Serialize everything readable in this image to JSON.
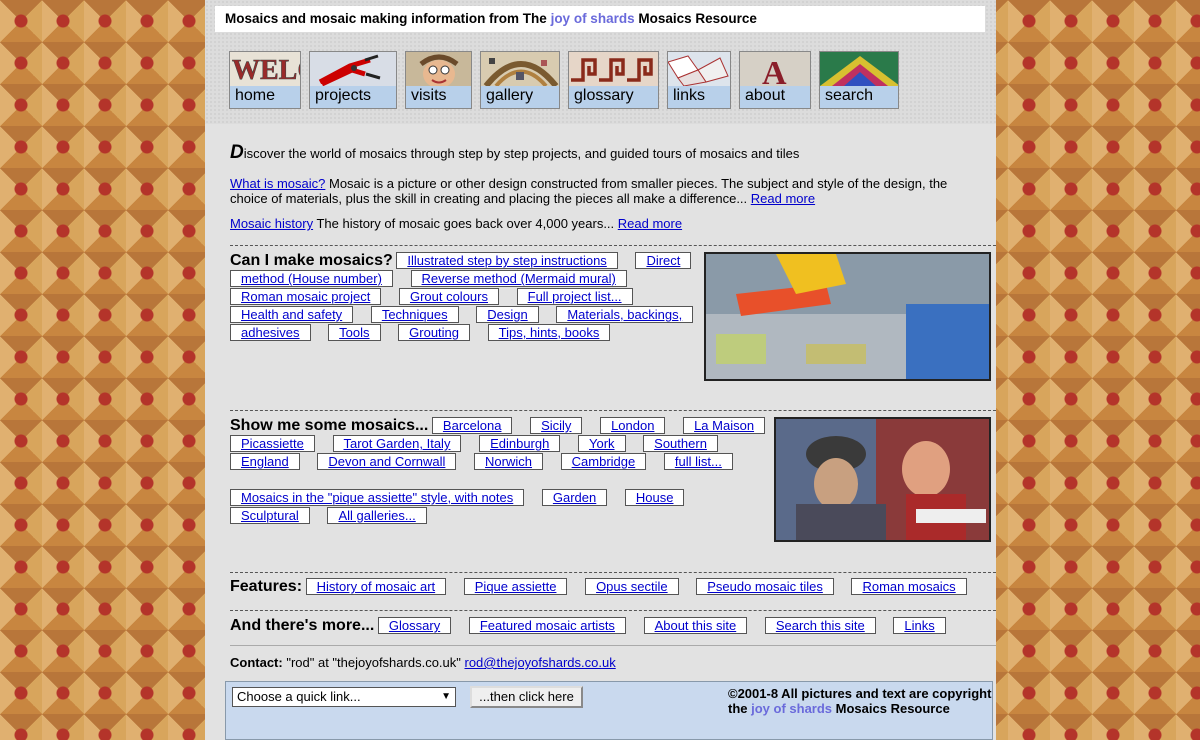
{
  "header": {
    "title_pre": "Mosaics and mosaic making information from The ",
    "title_brand": "joy of shards",
    "title_post": " Mosaics Resource"
  },
  "nav": [
    {
      "label": "home",
      "icon": "welcome-tile-icon"
    },
    {
      "label": "projects",
      "icon": "tile-nippers-icon"
    },
    {
      "label": "visits",
      "icon": "mosaic-face-icon"
    },
    {
      "label": "gallery",
      "icon": "mosaic-arch-icon"
    },
    {
      "label": "glossary",
      "icon": "greek-key-icon"
    },
    {
      "label": "links",
      "icon": "broken-tiles-icon"
    },
    {
      "label": "about",
      "icon": "letter-a-icon"
    },
    {
      "label": "search",
      "icon": "mosaic-pattern-icon"
    }
  ],
  "intro": {
    "dropcap": "D",
    "text": "iscover the world of mosaics through step by step projects, and guided tours of mosaics and tiles",
    "what_link": "What is mosaic?",
    "what_text": " Mosaic is a picture or other design constructed from smaller pieces. The subject and style of the design, the choice of materials, plus the skill in creating and placing the pieces all make a difference... ",
    "read_more": "Read more",
    "history_link": "Mosaic history",
    "history_text": " The history of mosaic goes back over 4,000 years... "
  },
  "make": {
    "heading": "Can I make mosaics?",
    "links": [
      "Illustrated step by step instructions",
      "Direct method (House number)",
      "Reverse method (Mermaid mural)",
      "Roman mosaic project",
      "Grout colours",
      "Full project list...",
      "Health and safety",
      "Techniques",
      "Design",
      "Materials, backings, adhesives",
      "Tools",
      "Grouting",
      "Tips, hints, books"
    ]
  },
  "show": {
    "heading": "Show me some mosaics...",
    "links": [
      "Barcelona",
      "Sicily",
      "London",
      "La Maison Picassiette",
      "Tarot Garden, Italy",
      "Edinburgh",
      "York",
      "Southern England",
      "Devon and Cornwall",
      "Norwich",
      "Cambridge",
      "full list..."
    ],
    "links2": [
      "Mosaics in the \"pique assiette\" style, with notes",
      "Garden",
      "House",
      "Sculptural",
      "All galleries..."
    ]
  },
  "features": {
    "heading": "Features:",
    "links": [
      "History of mosaic art",
      "Pique assiette",
      "Opus sectile",
      "Pseudo mosaic tiles",
      "Roman mosaics"
    ]
  },
  "more": {
    "heading": "And there's more...",
    "links": [
      "Glossary",
      "Featured mosaic artists",
      "About this site",
      "Search this site",
      "Links"
    ]
  },
  "contact": {
    "label": "Contact:",
    "text": " \"rod\" at \"thejoyofshards.co.uk\" ",
    "email": "rod@thejoyofshards.co.uk"
  },
  "footer": {
    "select_value": "Choose a quick link...",
    "button": "...then click here",
    "copy_line1": "©2001-8 All pictures and text are copyright",
    "copy_pre": "the ",
    "copy_brand": "joy of shards",
    "copy_post": " Mosaics Resource"
  },
  "colors": {
    "brand": "#6a6adb",
    "link": "#0000cc",
    "footer_bg": "#c9d9ee"
  }
}
